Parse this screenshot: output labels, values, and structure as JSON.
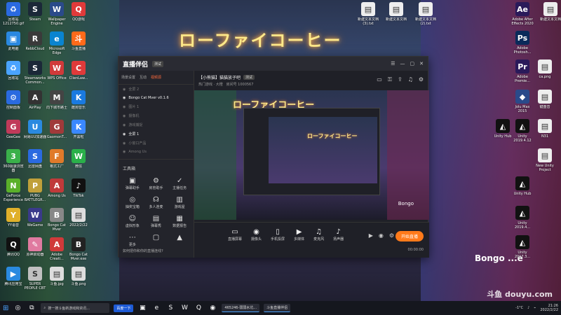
{
  "wallpaper": {
    "neon_sign": "ローファイコーヒー",
    "bongo_text": "Bongo ...e",
    "caption": "底部字幕区域（文字不可辨）"
  },
  "desktop_icons_left": [
    {
      "label": "回收站 1212750.gif",
      "color": "#2a6ae0",
      "glyph": "♻"
    },
    {
      "label": "Steam",
      "color": "#1b2838",
      "glyph": "S"
    },
    {
      "label": "Wallpaper Engine",
      "color": "#2a4a8a",
      "glyph": "W"
    },
    {
      "label": "QQ游戏",
      "color": "#e03a3a",
      "glyph": "Q"
    },
    {
      "label": "此电脑",
      "color": "#2a88e0",
      "glyph": "▣"
    },
    {
      "label": "RebbCloud",
      "color": "#3a3a3a",
      "glyph": "R"
    },
    {
      "label": "Microsoft Edge",
      "color": "#0a84d0",
      "glyph": "e"
    },
    {
      "label": "斗鱼直播",
      "color": "#ff6a1a",
      "glyph": "斗"
    },
    {
      "label": "回收站",
      "color": "#4aa3ff",
      "glyph": "♻"
    },
    {
      "label": "Steamworks Common...",
      "color": "#1b2838",
      "glyph": "S"
    },
    {
      "label": "WPS Office",
      "color": "#d03a3a",
      "glyph": "W"
    },
    {
      "label": "ClienLaw...",
      "color": "#e03a3a",
      "glyph": "C"
    },
    {
      "label": "控制面板",
      "color": "#2a6ae0",
      "glyph": "⚙"
    },
    {
      "label": "AirPlay",
      "color": "#333",
      "glyph": "A"
    },
    {
      "label": "向下城市路士",
      "color": "#444",
      "glyph": "M"
    },
    {
      "label": "酷狗音乐",
      "color": "#1a7ae0",
      "glyph": "K"
    },
    {
      "label": "GeeGee",
      "color": "#c03a5a",
      "glyph": "G"
    },
    {
      "label": "网易UU加速器",
      "color": "#2a8ae0",
      "glyph": "U"
    },
    {
      "label": "GaomonT...",
      "color": "#a03a3a",
      "glyph": "G"
    },
    {
      "label": "开黑啦",
      "color": "#3a88ff",
      "glyph": "K"
    },
    {
      "label": "360极速浏览器",
      "color": "#3ab04a",
      "glyph": "3"
    },
    {
      "label": "迅雷网盘",
      "color": "#2a6ae0",
      "glyph": "S"
    },
    {
      "label": "格式工厂",
      "color": "#e07a2a",
      "glyph": "F"
    },
    {
      "label": "微信",
      "color": "#2ab04a",
      "glyph": "W"
    },
    {
      "label": "GeForce Experience",
      "color": "#5ab02a",
      "glyph": "N"
    },
    {
      "label": "PUBG BATTLEGR...",
      "color": "#c0a03a",
      "glyph": "P"
    },
    {
      "label": "Among Us",
      "color": "#c03a3a",
      "glyph": "A"
    },
    {
      "label": "TikTok",
      "color": "#111",
      "glyph": "♪"
    },
    {
      "label": "YY语音",
      "color": "#e0b02a",
      "glyph": "Y"
    },
    {
      "label": "WeGame",
      "color": "#3a3a8a",
      "glyph": "W"
    },
    {
      "label": "Bongo Cat Mver",
      "color": "#888",
      "glyph": "B"
    },
    {
      "label": "2022/2/22",
      "color": "#ddd",
      "glyph": "▤"
    },
    {
      "label": "腾讯QQ",
      "color": "#111",
      "glyph": "Q"
    },
    {
      "label": "原神启动器",
      "color": "#e07aa0",
      "glyph": "✎"
    },
    {
      "label": "Adobe Creati...",
      "color": "#d03a3a",
      "glyph": "A"
    },
    {
      "label": "Bongo Cat Mver.exe",
      "color": "#222",
      "glyph": "B"
    },
    {
      "label": "腾讯应用宝",
      "color": "#2a8ae0",
      "glyph": "▶"
    },
    {
      "label": "SUPER PEOPLE CBT",
      "color": "#c0c0c0",
      "glyph": "S"
    },
    {
      "label": "斗鱼.jpg",
      "color": "#ddd",
      "glyph": "▤"
    },
    {
      "label": "斗鱼.png",
      "color": "#ddd",
      "glyph": "▤"
    }
  ],
  "desktop_icons_right": [
    {
      "label": "新建文本文档 (3).txt",
      "color": "#eee",
      "glyph": "▤"
    },
    {
      "label": "新建文本文档",
      "color": "#eee",
      "glyph": "▤"
    },
    {
      "label": "新建文本文档 (2).txt",
      "color": "#eee",
      "glyph": "▤"
    },
    {
      "label": "Adobe After Effects 2020",
      "color": "#2a1a5a",
      "glyph": "Ae"
    },
    {
      "label": "新建文本文档",
      "color": "#eee",
      "glyph": "▤"
    },
    {
      "label": "Adobe Photosh...",
      "color": "#0a2a5a",
      "glyph": "Ps"
    },
    {
      "label": "Adobe Premie...",
      "color": "#2a1a5a",
      "glyph": "Pr"
    },
    {
      "label": "ca.png",
      "color": "#eee",
      "glyph": "▤"
    },
    {
      "label": "Jolu Max 2015",
      "color": "#2a4a8a",
      "glyph": "◆"
    },
    {
      "label": "键盘音",
      "color": "#eee",
      "glyph": "▤"
    },
    {
      "label": "Unity Hub",
      "color": "#111",
      "glyph": "◭"
    },
    {
      "label": "N31",
      "color": "#eee",
      "glyph": "▤"
    },
    {
      "label": "Unity 2019.4.12",
      "color": "#111",
      "glyph": "◭"
    },
    {
      "label": "New Unity Project",
      "color": "#eee",
      "glyph": "▤"
    },
    {
      "label": "Unity Hub",
      "color": "#111",
      "glyph": "◭"
    },
    {
      "label": "Unity 2019.4...",
      "color": "#111",
      "glyph": "◭"
    },
    {
      "label": "Unity 2017.3...",
      "color": "#111",
      "glyph": "◭"
    }
  ],
  "app": {
    "logo": "直播伴侣",
    "version": "测试",
    "tabs": [
      "场景设置",
      "互动",
      "视频源"
    ],
    "active_tab": "视频源",
    "sources": [
      {
        "name": "全屏 2",
        "bright": false
      },
      {
        "name": "Bongo Cat Mver v0.1.6",
        "bright": true
      },
      {
        "name": "图片 1",
        "bright": false
      },
      {
        "name": "摄像机",
        "bright": false
      },
      {
        "name": "游戏捕捉",
        "bright": false
      },
      {
        "name": "全屏 1",
        "bright": true
      },
      {
        "name": "小窗口产品",
        "bright": false
      },
      {
        "name": "Among Us",
        "bright": false
      }
    ],
    "tools_title": "工具箱",
    "tools": [
      {
        "label": "弹幕助手",
        "icon": "▣"
      },
      {
        "label": "房管助手",
        "icon": "⚙"
      },
      {
        "label": "主播任务",
        "icon": "✓"
      },
      {
        "label": "抽奖宝箱",
        "icon": "◎"
      },
      {
        "label": "多人连麦",
        "icon": "☊"
      },
      {
        "label": "游戏屋",
        "icon": "▥"
      },
      {
        "label": "虚拟形象",
        "icon": "☺"
      },
      {
        "label": "弹幕秀",
        "icon": "▤"
      },
      {
        "label": "数据报告",
        "icon": "▦"
      },
      {
        "label": "更多",
        "icon": "⋯"
      },
      {
        "label": "",
        "icon": "▢"
      },
      {
        "label": "",
        "icon": "▲"
      }
    ],
    "footer_hint": "如何把你和你的直播连线?",
    "room_title": "【小熊猫】猫猫放子吧",
    "room_tag": "测试",
    "room_meta_category": "热门游戏 · 大橙",
    "room_meta_id": "房间号 1000567",
    "preview_sign": "ローファイコーヒー",
    "preview_bongo": "Bongo",
    "bottom_tools": [
      {
        "label": "直播屏幕",
        "icon": "▭"
      },
      {
        "label": "摄像头",
        "icon": "◉"
      },
      {
        "label": "手机投屏",
        "icon": "▯"
      },
      {
        "label": "多媒体",
        "icon": "▶"
      },
      {
        "label": "麦克风",
        "icon": "♫"
      },
      {
        "label": "扬声器",
        "icon": "♪"
      }
    ],
    "go_live": "开始直播",
    "timer": "00:00:00"
  },
  "taskbar": {
    "search_placeholder": "搜一搜斗鱼新游戏和资讯...",
    "search_btn": "百度一下",
    "task1": "465246-弱弱水坑...",
    "task2": "斗鱼直播伴侣",
    "weather": "-1°C",
    "time": "21:26",
    "date": "2022/2/22"
  },
  "watermark": "斗鱼 douyu.com"
}
